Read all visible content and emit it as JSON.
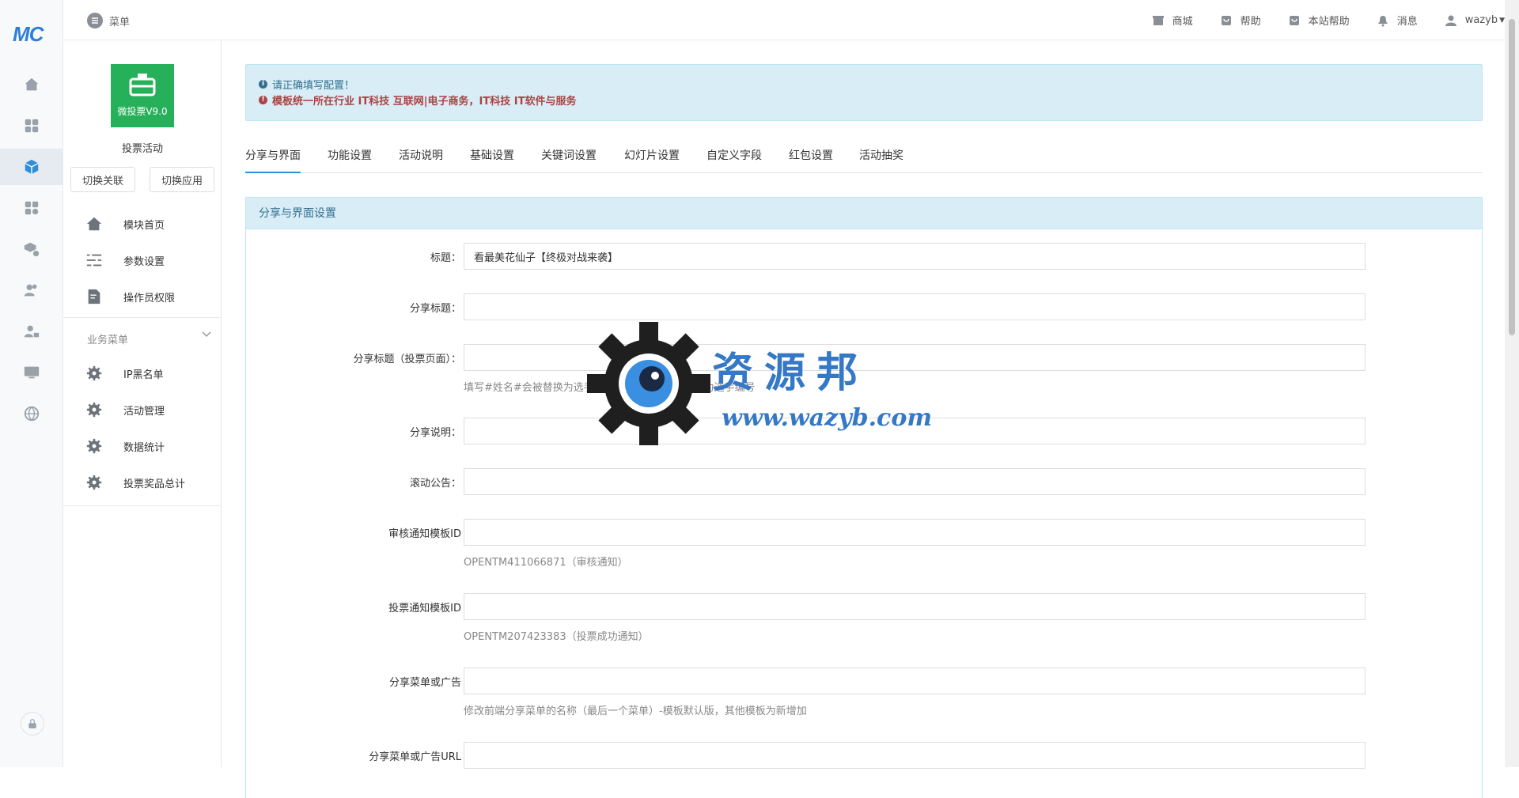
{
  "brand": {
    "logo_text": "MC"
  },
  "topbar": {
    "menu_label": "菜单",
    "links": [
      {
        "label": "商城",
        "icon": "store-icon"
      },
      {
        "label": "帮助",
        "icon": "help-bag-icon"
      },
      {
        "label": "本站帮助",
        "icon": "site-help-icon"
      },
      {
        "label": "消息",
        "icon": "bell-icon"
      },
      {
        "label": "wazyb",
        "icon": "user-icon"
      }
    ]
  },
  "module": {
    "logo_label": "微投票V9.0",
    "name": "投票活动",
    "switch_link_label": "切换关联",
    "switch_app_label": "切换应用"
  },
  "sidenav": {
    "items": [
      {
        "label": "模块首页",
        "icon": "home-icon"
      },
      {
        "label": "参数设置",
        "icon": "list-settings-icon"
      },
      {
        "label": "操作员权限",
        "icon": "doc-edit-icon"
      }
    ],
    "group_title": "业务菜单",
    "group_items": [
      {
        "label": "IP黑名单",
        "icon": "gear-icon"
      },
      {
        "label": "活动管理",
        "icon": "gear-icon"
      },
      {
        "label": "数据统计",
        "icon": "gear-icon"
      },
      {
        "label": "投票奖品总计",
        "icon": "gear-icon"
      }
    ]
  },
  "alert": {
    "line1": "请正确填写配置！",
    "line2": "模板统一所在行业 IT科技 互联网|电子商务，IT科技 IT软件与服务",
    "color_info": "#31708f",
    "color_danger": "#a94442"
  },
  "tabs": [
    "分享与界面",
    "功能设置",
    "活动说明",
    "基础设置",
    "关键词设置",
    "幻灯片设置",
    "自定义字段",
    "红包设置",
    "活动抽奖"
  ],
  "panel": {
    "title": "分享与界面设置",
    "fields": [
      {
        "label": "标题：",
        "value": "看最美花仙子【终极对战来袭】",
        "help": ""
      },
      {
        "label": "分享标题：",
        "value": "",
        "help": ""
      },
      {
        "label": "分享标题（投票页面）：",
        "value": "",
        "help": "填写#姓名#会被替换为选手姓名，#编号#会被替换为选手编号"
      },
      {
        "label": "分享说明：",
        "value": "",
        "help": ""
      },
      {
        "label": "滚动公告：",
        "value": "",
        "help": ""
      },
      {
        "label": "审核通知模板ID",
        "value": "",
        "help": "OPENTM411066871（审核通知）"
      },
      {
        "label": "投票通知模板ID",
        "value": "",
        "help": "OPENTM207423383（投票成功通知）"
      },
      {
        "label": "分享菜单或广告",
        "value": "",
        "help": "修改前端分享菜单的名称（最后一个菜单）-模板默认版，其他模板为新增加"
      },
      {
        "label": "分享菜单或广告URL",
        "value": "",
        "help": ""
      }
    ]
  },
  "watermark": {
    "title": "资源邦",
    "url": "www.wazyb.com"
  },
  "colors": {
    "accent": "#2f8ed8",
    "module_green": "#27b05a",
    "panel_head": "#d9edf7"
  }
}
